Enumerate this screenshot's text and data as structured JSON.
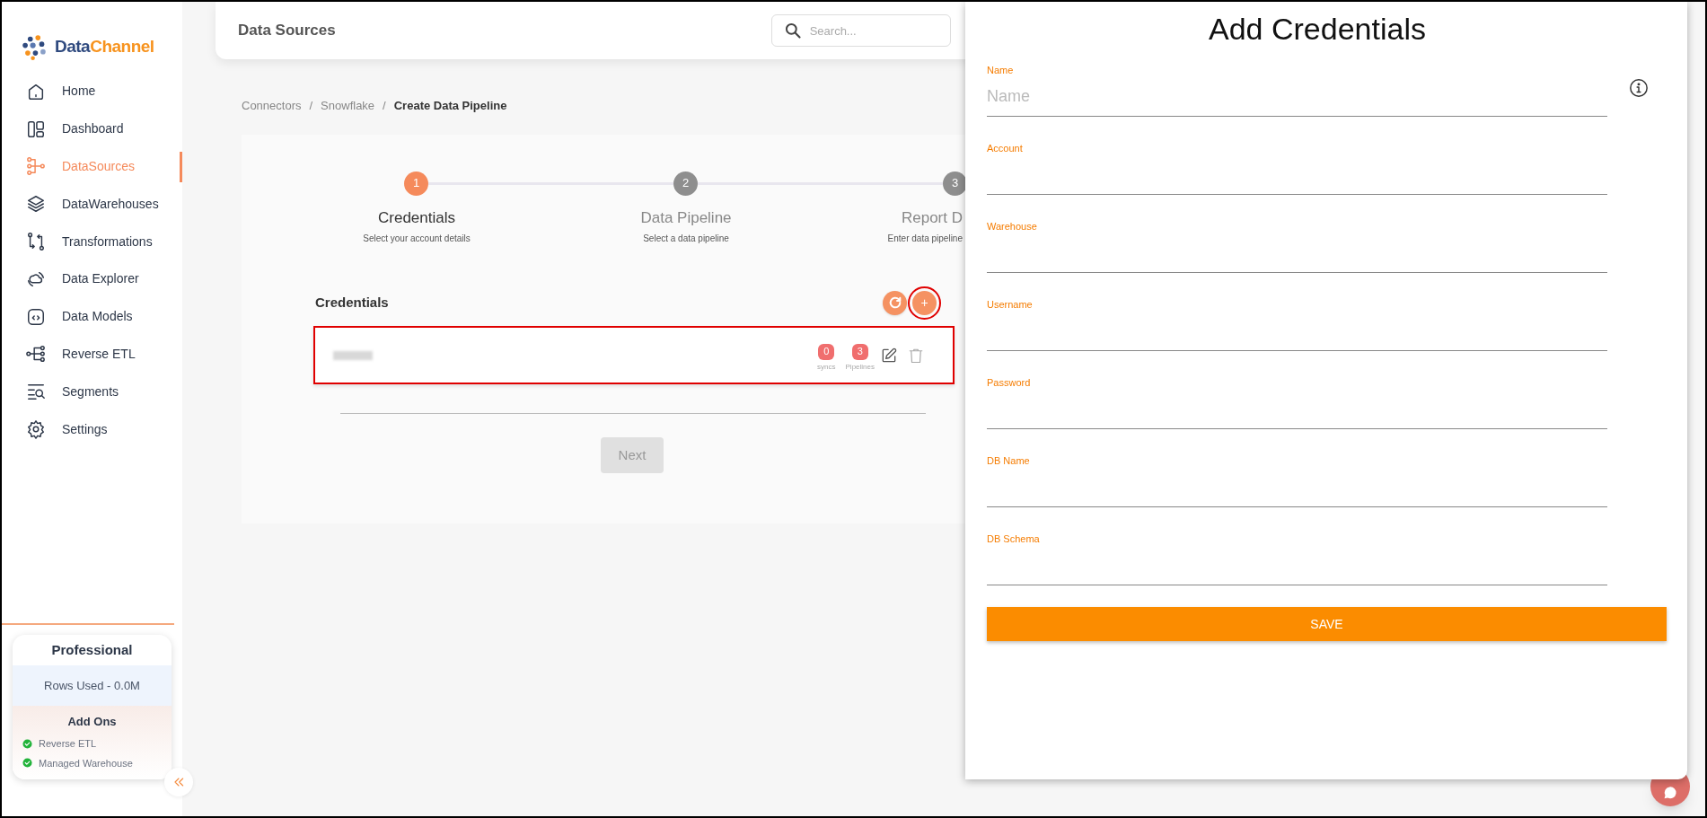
{
  "sidebar": {
    "logo": {
      "part_1": "Data",
      "part_2": "Channel"
    },
    "items": [
      {
        "kind": "home",
        "label": "Home",
        "selected": false
      },
      {
        "kind": "dashboard",
        "label": "Dashboard",
        "selected": false
      },
      {
        "kind": "sources",
        "label": "DataSources",
        "selected": true
      },
      {
        "kind": "layers",
        "label": "DataWarehouses",
        "selected": false
      },
      {
        "kind": "transform",
        "label": "Transformations",
        "selected": false
      },
      {
        "kind": "explorer",
        "label": "Data Explorer",
        "selected": false
      },
      {
        "kind": "models",
        "label": "Data Models",
        "selected": false
      },
      {
        "kind": "reverse",
        "label": "Reverse ETL",
        "selected": false
      },
      {
        "kind": "segments",
        "label": "Segments",
        "selected": false
      },
      {
        "kind": "settings",
        "label": "Settings",
        "selected": false
      }
    ],
    "plan": {
      "name": "Professional",
      "usage": "Rows Used - 0.0M",
      "addons_title": "Add Ons",
      "addons": [
        {
          "label": "Reverse ETL",
          "enabled": true
        },
        {
          "label": "Managed Warehouse",
          "enabled": true
        }
      ]
    }
  },
  "header": {
    "title": "Data Sources",
    "search": {
      "placeholder": "Search..."
    }
  },
  "breadcrumb": [
    {
      "label": "Connectors",
      "current": false
    },
    {
      "label": "Snowflake",
      "current": false
    },
    {
      "label": "Create Data Pipeline",
      "current": true
    }
  ],
  "separator": "/",
  "stepper": [
    {
      "number": "1",
      "title": "Credentials",
      "subtitle": "Select your account details",
      "selected": true
    },
    {
      "number": "2",
      "title": "Data Pipeline",
      "subtitle": "Select a data pipeline",
      "selected": false
    },
    {
      "number": "3",
      "title": "Report D",
      "subtitle": "Enter data pipeline",
      "selected": false
    }
  ],
  "credentials": {
    "title": "Credentials",
    "add_button": "+",
    "rows": [
      {
        "syncs": "0",
        "syncs_label": "syncs",
        "pipelines": "3",
        "pipelines_label": "Pipelines",
        "highlighted": true
      }
    ]
  },
  "next_button": {
    "label": "Next",
    "disabled": true
  },
  "drawer": {
    "title": "Add Credentials",
    "fields": [
      {
        "label": "Name",
        "placeholder": "Name",
        "info": true
      },
      {
        "label": "Account",
        "info": false
      },
      {
        "label": "Warehouse",
        "info": false
      },
      {
        "label": "Username",
        "info": false
      },
      {
        "label": "Password",
        "info": false
      },
      {
        "label": "DB Name",
        "info": false
      },
      {
        "label": "DB Schema",
        "info": false
      }
    ],
    "save_button": "SAVE"
  }
}
